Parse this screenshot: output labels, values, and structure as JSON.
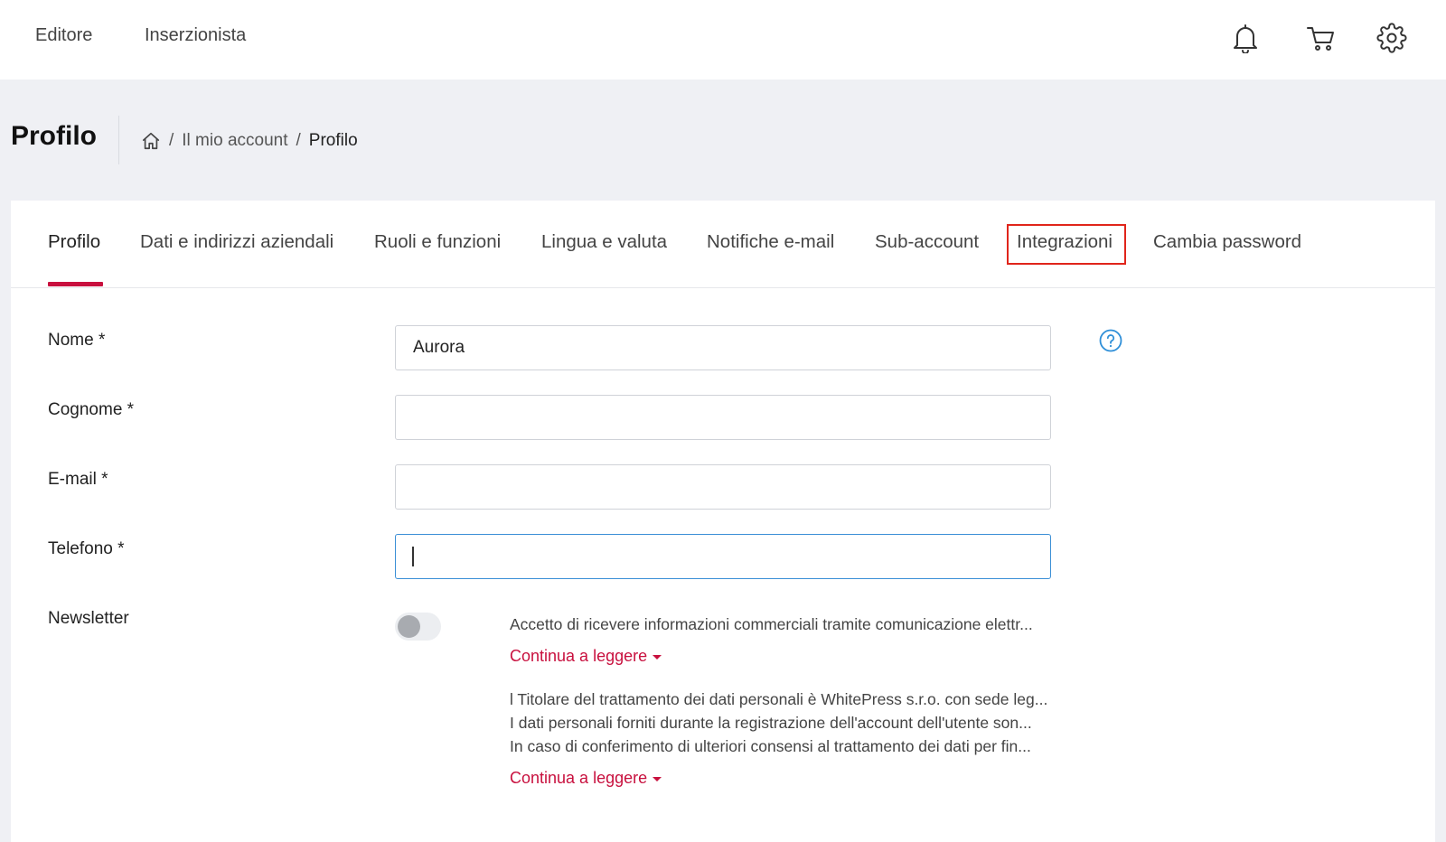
{
  "topnav": {
    "editor_label": "Editore",
    "advertiser_label": "Inserzionista"
  },
  "icons": {
    "notifications": "bell-icon",
    "cart": "cart-icon",
    "settings": "gear-icon"
  },
  "header": {
    "title": "Profilo",
    "breadcrumb": {
      "home_icon": "home-icon",
      "account": "Il mio account",
      "current": "Profilo",
      "separator": "/"
    }
  },
  "tabs": [
    {
      "label": "Profilo",
      "active": true
    },
    {
      "label": "Dati e indirizzi aziendali",
      "active": false
    },
    {
      "label": "Ruoli e funzioni",
      "active": false
    },
    {
      "label": "Lingua e valuta",
      "active": false
    },
    {
      "label": "Notifiche e-mail",
      "active": false
    },
    {
      "label": "Sub-account",
      "active": false
    },
    {
      "label": "Integrazioni",
      "active": false,
      "highlighted": true
    },
    {
      "label": "Cambia password",
      "active": false
    }
  ],
  "form": {
    "first_name": {
      "label": "Nome *",
      "value": "Aurora"
    },
    "last_name": {
      "label": "Cognome *",
      "value": ""
    },
    "email": {
      "label": "E-mail *",
      "value": ""
    },
    "phone": {
      "label": "Telefono *",
      "value": ""
    },
    "newsletter": {
      "label": "Newsletter",
      "enabled": false,
      "consent_text": "Accetto di ricevere informazioni commerciali tramite comunicazione elettr...",
      "read_more": "Continua a leggere"
    },
    "privacy": {
      "lines": [
        "l Titolare del trattamento dei dati personali è WhitePress s.r.o. con sede leg...",
        "I dati personali forniti durante la registrazione dell'account dell'utente son...",
        "In caso di conferimento di ulteriori consensi al trattamento dei dati per fin..."
      ],
      "read_more": "Continua a leggere"
    },
    "help_icon": "question-circle-icon"
  },
  "colors": {
    "accent": "#c8103e",
    "focus": "#3b8fd6",
    "highlight_box": "#e0251b",
    "page_bg": "#eff0f4"
  }
}
